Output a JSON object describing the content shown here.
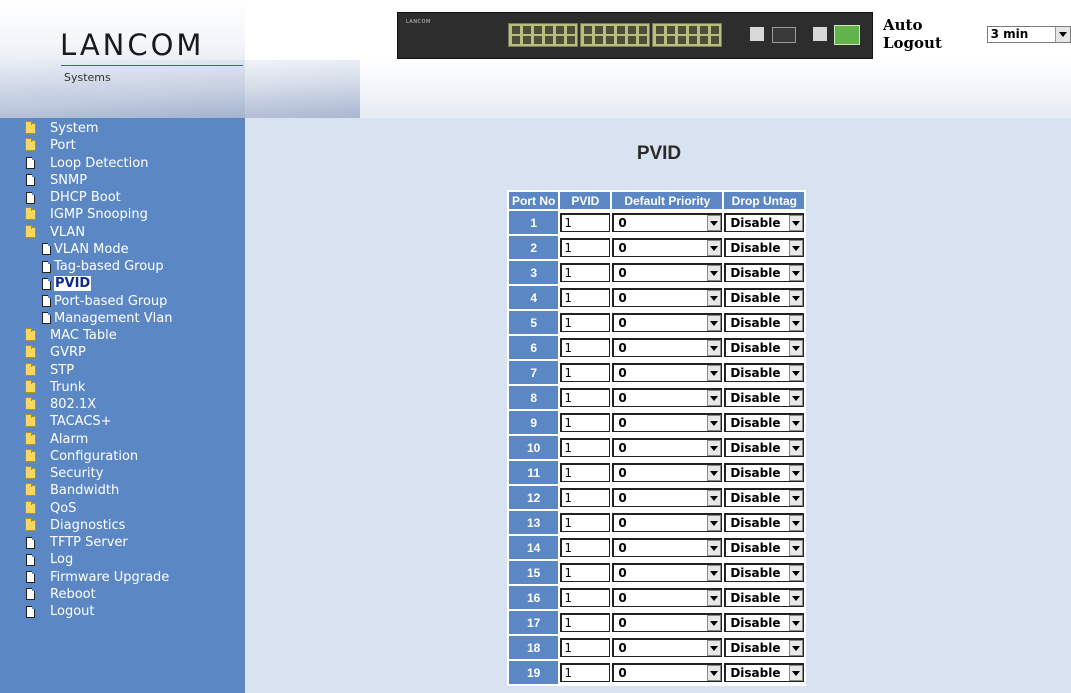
{
  "header": {
    "logo": "LANCOM",
    "logo_sub": "Systems",
    "device_brand": "LANCOM",
    "auto_logout_label": "Auto Logout",
    "auto_logout_value": "3 min"
  },
  "sidebar": {
    "items": [
      {
        "label": "System",
        "icon": "folder-icon",
        "level": 0
      },
      {
        "label": "Port",
        "icon": "folder-icon",
        "level": 0
      },
      {
        "label": "Loop Detection",
        "icon": "document-icon",
        "level": 0
      },
      {
        "label": "SNMP",
        "icon": "document-icon",
        "level": 0
      },
      {
        "label": "DHCP Boot",
        "icon": "document-icon",
        "level": 0
      },
      {
        "label": "IGMP Snooping",
        "icon": "folder-icon",
        "level": 0
      },
      {
        "label": "VLAN",
        "icon": "folder-icon",
        "level": 0
      },
      {
        "label": "VLAN Mode",
        "icon": "document-icon",
        "level": 1
      },
      {
        "label": "Tag-based Group",
        "icon": "document-icon",
        "level": 1
      },
      {
        "label": "PVID",
        "icon": "document-icon",
        "level": 1,
        "active": true
      },
      {
        "label": "Port-based Group",
        "icon": "document-icon",
        "level": 1
      },
      {
        "label": "Management Vlan",
        "icon": "document-icon",
        "level": 1
      },
      {
        "label": "MAC Table",
        "icon": "folder-icon",
        "level": 0
      },
      {
        "label": "GVRP",
        "icon": "folder-icon",
        "level": 0
      },
      {
        "label": "STP",
        "icon": "folder-icon",
        "level": 0
      },
      {
        "label": "Trunk",
        "icon": "folder-icon",
        "level": 0
      },
      {
        "label": "802.1X",
        "icon": "folder-icon",
        "level": 0
      },
      {
        "label": "TACACS+",
        "icon": "folder-icon",
        "level": 0
      },
      {
        "label": "Alarm",
        "icon": "folder-icon",
        "level": 0
      },
      {
        "label": "Configuration",
        "icon": "folder-icon",
        "level": 0
      },
      {
        "label": "Security",
        "icon": "folder-icon",
        "level": 0
      },
      {
        "label": "Bandwidth",
        "icon": "folder-icon",
        "level": 0
      },
      {
        "label": "QoS",
        "icon": "folder-icon",
        "level": 0
      },
      {
        "label": "Diagnostics",
        "icon": "folder-icon",
        "level": 0
      },
      {
        "label": "TFTP Server",
        "icon": "document-icon",
        "level": 0
      },
      {
        "label": "Log",
        "icon": "document-icon",
        "level": 0
      },
      {
        "label": "Firmware Upgrade",
        "icon": "document-icon",
        "level": 0
      },
      {
        "label": "Reboot",
        "icon": "document-icon",
        "level": 0
      },
      {
        "label": "Logout",
        "icon": "document-icon",
        "level": 0
      }
    ]
  },
  "main": {
    "title": "PVID",
    "table": {
      "headers": [
        "Port No",
        "PVID",
        "Default Priority",
        "Drop Untag"
      ],
      "rows": [
        {
          "port": "1",
          "pvid": "1",
          "priority": "0",
          "drop_untag": "Disable"
        },
        {
          "port": "2",
          "pvid": "1",
          "priority": "0",
          "drop_untag": "Disable"
        },
        {
          "port": "3",
          "pvid": "1",
          "priority": "0",
          "drop_untag": "Disable"
        },
        {
          "port": "4",
          "pvid": "1",
          "priority": "0",
          "drop_untag": "Disable"
        },
        {
          "port": "5",
          "pvid": "1",
          "priority": "0",
          "drop_untag": "Disable"
        },
        {
          "port": "6",
          "pvid": "1",
          "priority": "0",
          "drop_untag": "Disable"
        },
        {
          "port": "7",
          "pvid": "1",
          "priority": "0",
          "drop_untag": "Disable"
        },
        {
          "port": "8",
          "pvid": "1",
          "priority": "0",
          "drop_untag": "Disable"
        },
        {
          "port": "9",
          "pvid": "1",
          "priority": "0",
          "drop_untag": "Disable"
        },
        {
          "port": "10",
          "pvid": "1",
          "priority": "0",
          "drop_untag": "Disable"
        },
        {
          "port": "11",
          "pvid": "1",
          "priority": "0",
          "drop_untag": "Disable"
        },
        {
          "port": "12",
          "pvid": "1",
          "priority": "0",
          "drop_untag": "Disable"
        },
        {
          "port": "13",
          "pvid": "1",
          "priority": "0",
          "drop_untag": "Disable"
        },
        {
          "port": "14",
          "pvid": "1",
          "priority": "0",
          "drop_untag": "Disable"
        },
        {
          "port": "15",
          "pvid": "1",
          "priority": "0",
          "drop_untag": "Disable"
        },
        {
          "port": "16",
          "pvid": "1",
          "priority": "0",
          "drop_untag": "Disable"
        },
        {
          "port": "17",
          "pvid": "1",
          "priority": "0",
          "drop_untag": "Disable"
        },
        {
          "port": "18",
          "pvid": "1",
          "priority": "0",
          "drop_untag": "Disable"
        },
        {
          "port": "19",
          "pvid": "1",
          "priority": "0",
          "drop_untag": "Disable"
        }
      ]
    }
  }
}
